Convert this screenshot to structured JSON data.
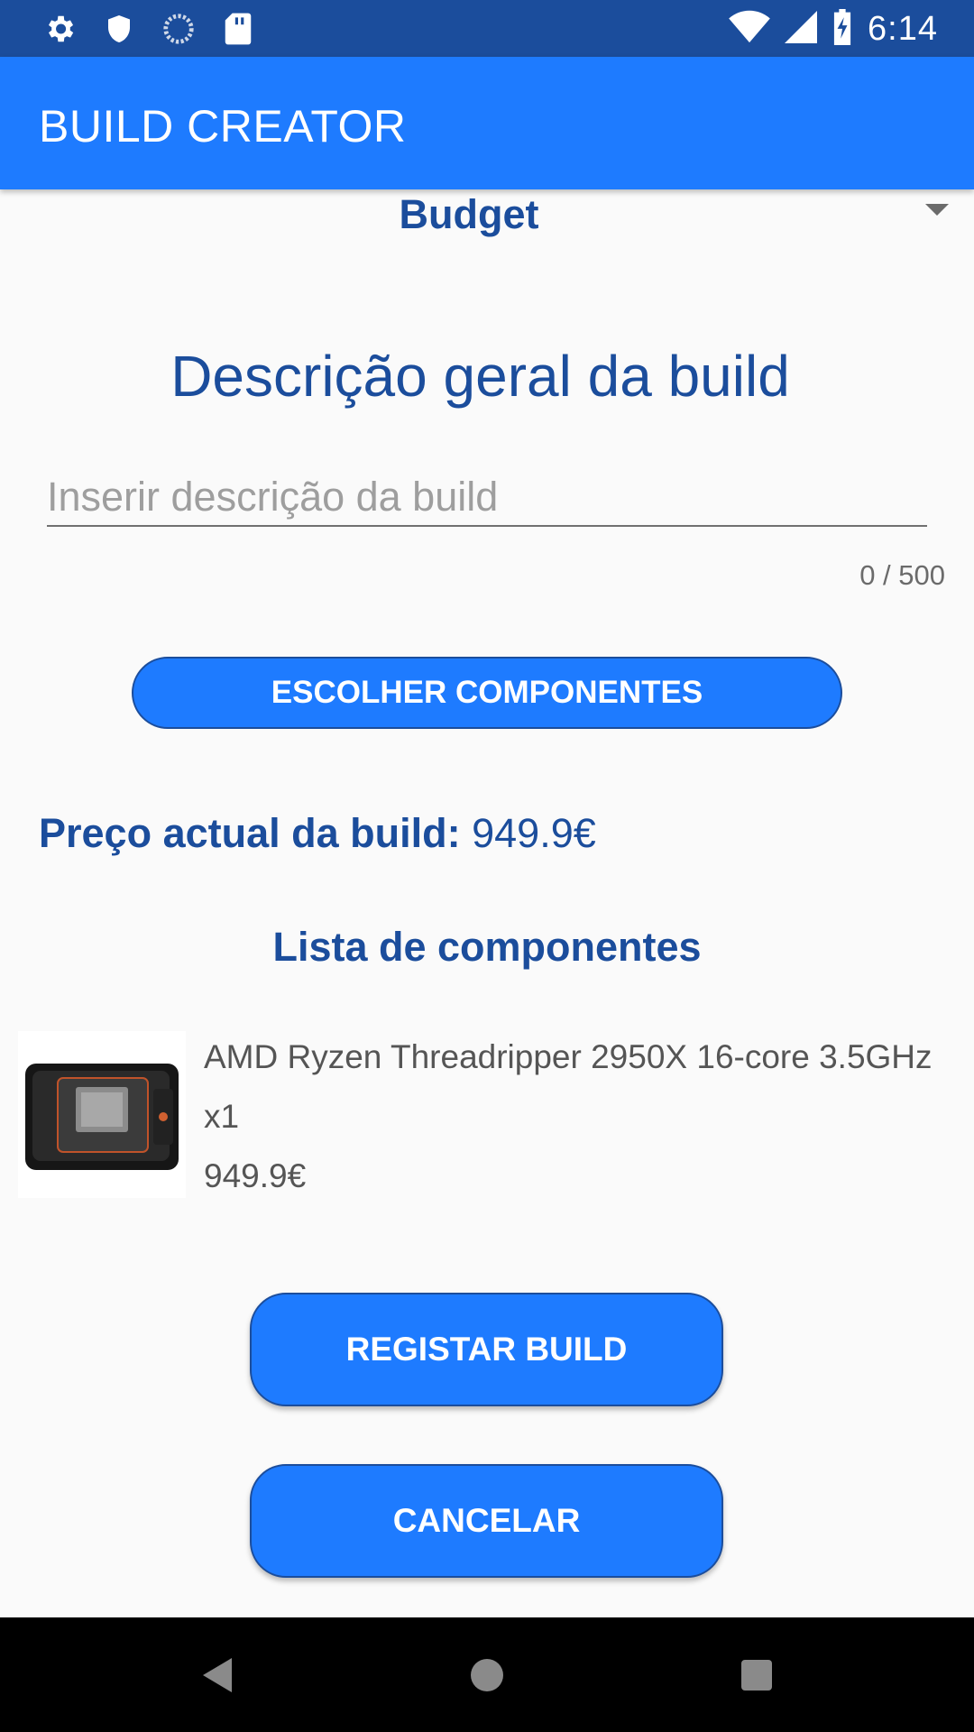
{
  "status_bar": {
    "time": "6:14",
    "left_icons": [
      "gear-icon",
      "shield-icon",
      "sync-icon",
      "sd-card-icon"
    ],
    "right_icons": [
      "wifi-icon",
      "signal-icon",
      "battery-charging-icon"
    ]
  },
  "app_bar": {
    "title": "BUILD CREATOR"
  },
  "spinner": {
    "selected": "Budget"
  },
  "form": {
    "section_title": "Descrição geral da build",
    "description_placeholder": "Inserir descrição da build",
    "description_value": "",
    "counter": "0 / 500",
    "choose_button": "ESCOLHER COMPONENTES"
  },
  "price": {
    "label": "Preço actual da build:",
    "value": "949.9€"
  },
  "components": {
    "title": "Lista de componentes",
    "items": [
      {
        "name": "AMD Ryzen Threadripper 2950X 16-core 3.5GHz",
        "quantity": "x1",
        "price": "949.9€"
      }
    ]
  },
  "actions": {
    "register": "REGISTAR BUILD",
    "cancel": "CANCELAR"
  },
  "colors": {
    "status_bar": "#1b4d9c",
    "app_bar": "#1e7bff",
    "primary_text": "#1b4d9c",
    "button": "#1e7bff"
  }
}
